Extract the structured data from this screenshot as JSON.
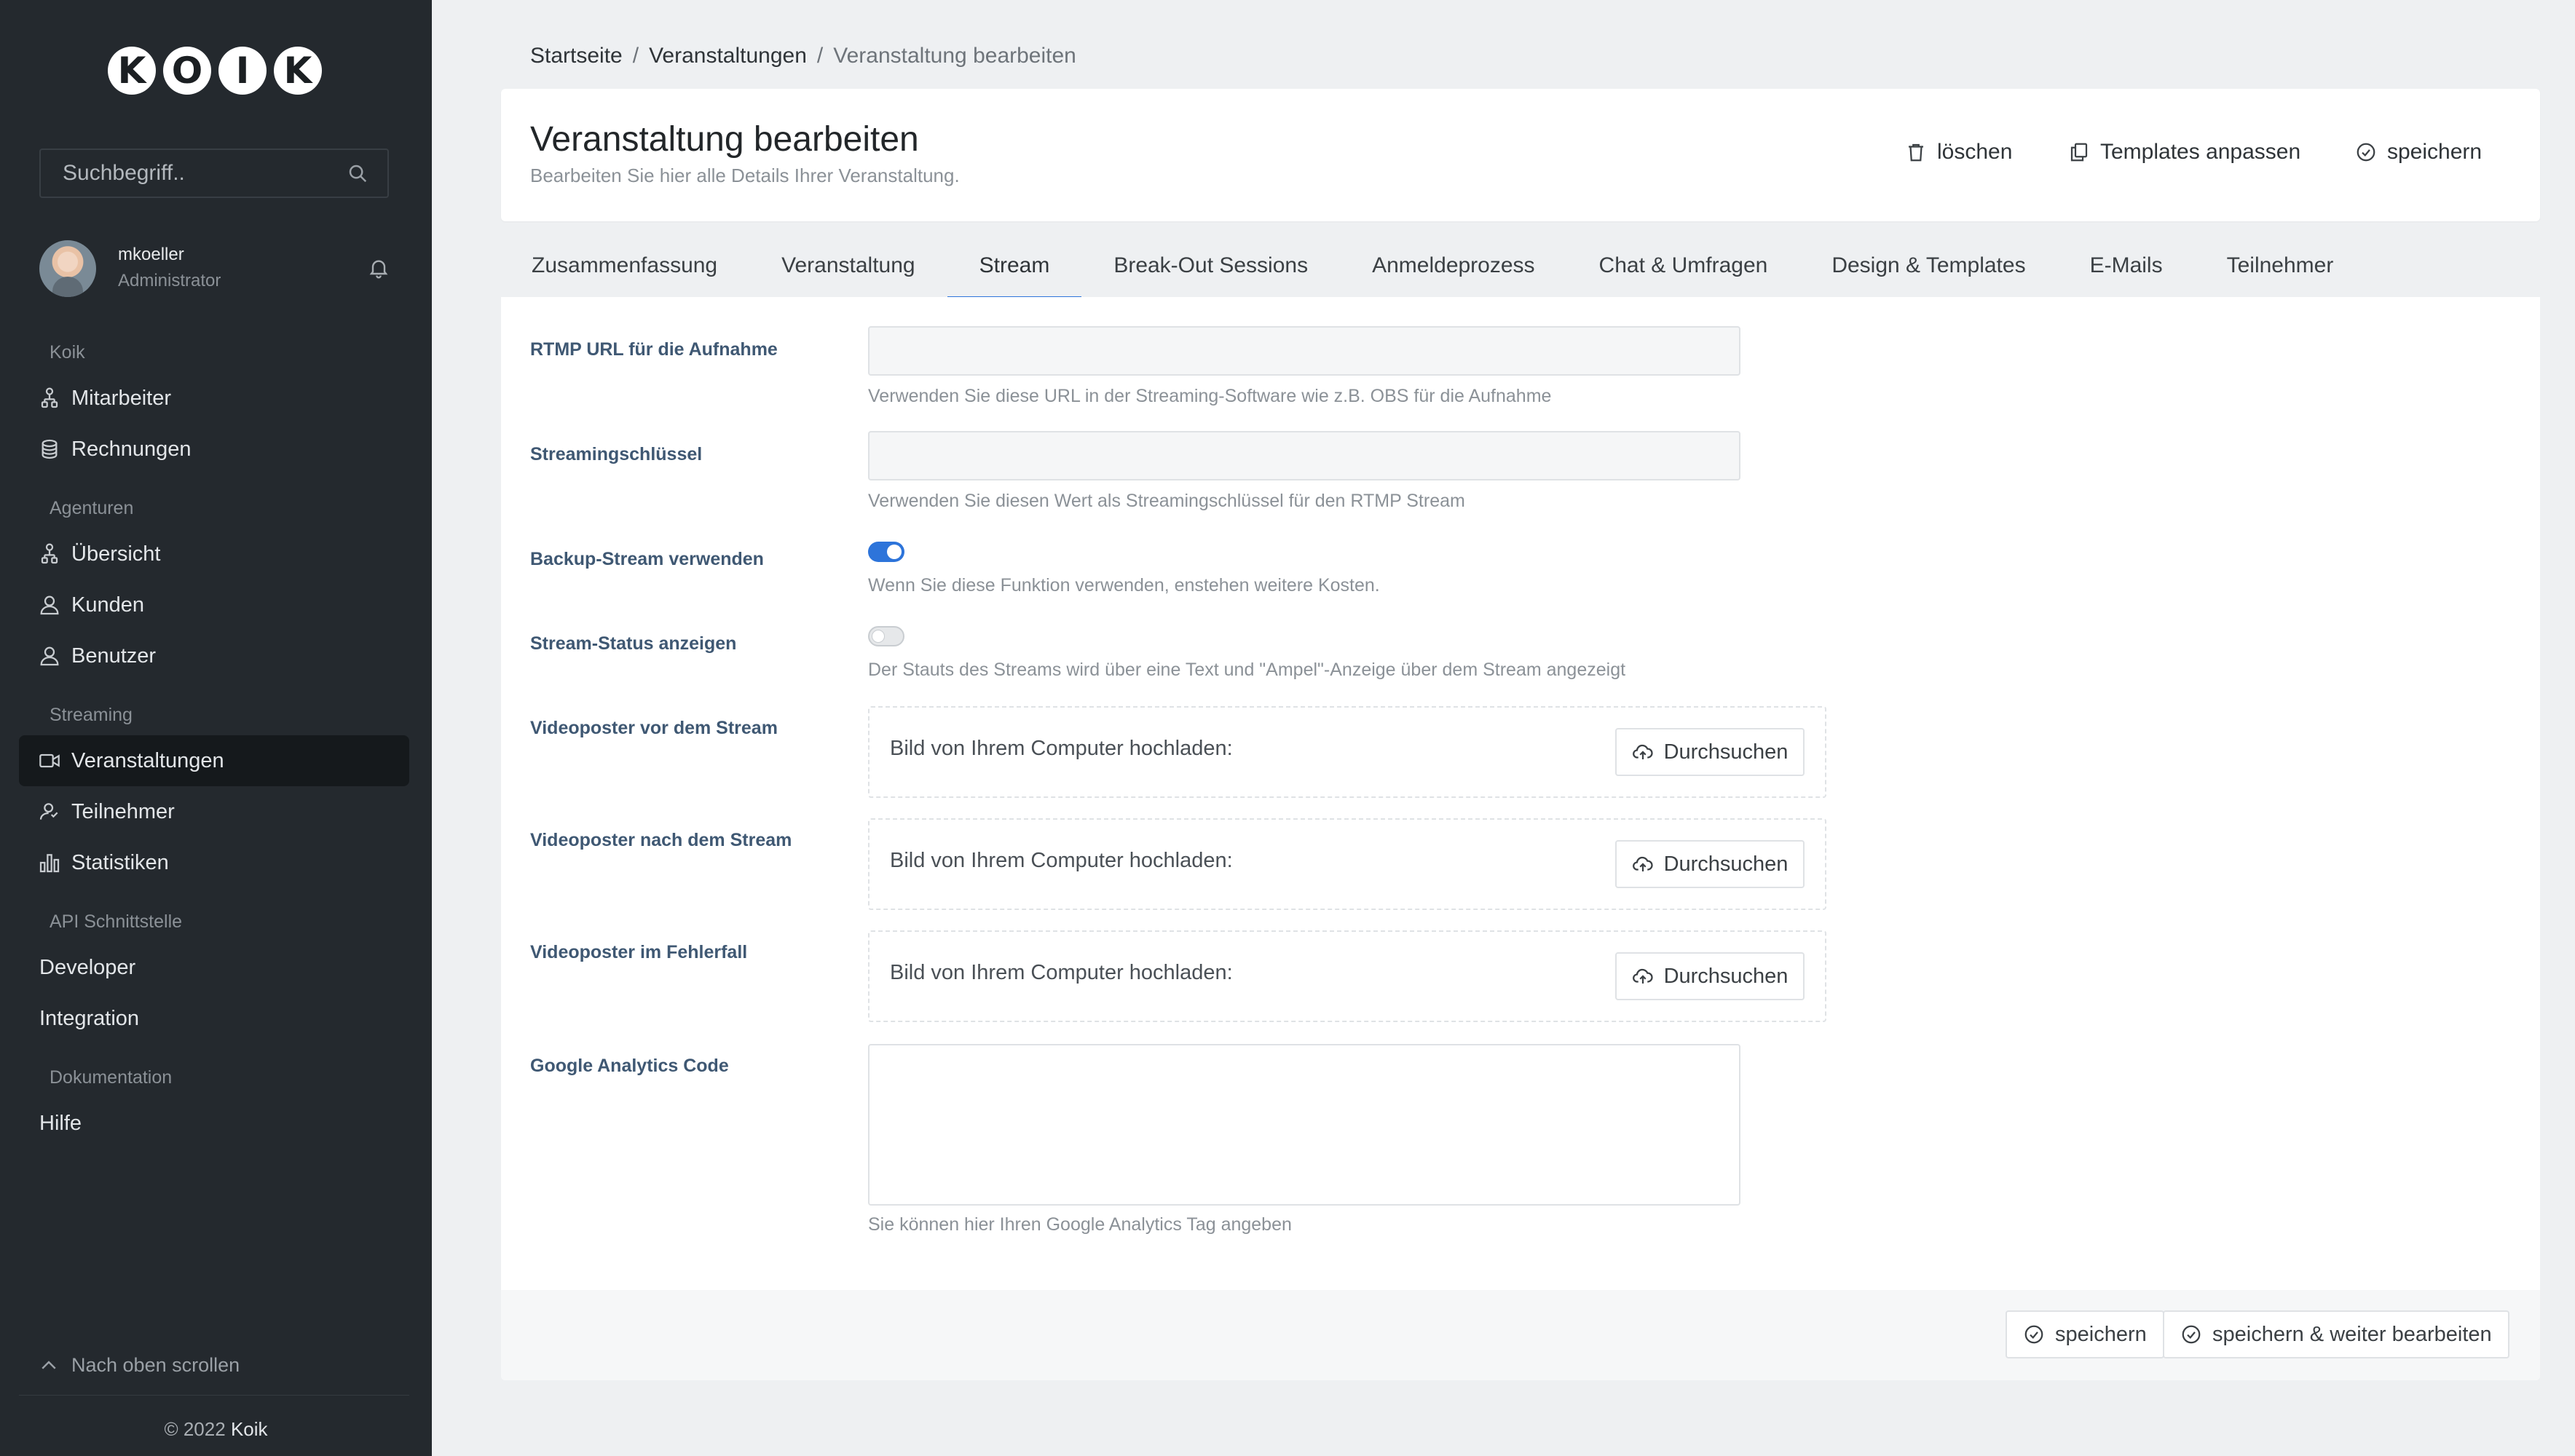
{
  "brand": {
    "logo_letters": [
      "K",
      "O",
      "I",
      "K"
    ]
  },
  "search": {
    "placeholder": "Suchbegriff.."
  },
  "user": {
    "name": "mkoeller",
    "role": "Administrator"
  },
  "sidebar": {
    "sections": [
      {
        "title": "Koik",
        "items": [
          {
            "label": "Mitarbeiter",
            "icon": "users-icon"
          },
          {
            "label": "Rechnungen",
            "icon": "coins-icon"
          }
        ]
      },
      {
        "title": "Agenturen",
        "items": [
          {
            "label": "Übersicht",
            "icon": "users-icon"
          },
          {
            "label": "Kunden",
            "icon": "user-icon"
          },
          {
            "label": "Benutzer",
            "icon": "user-icon"
          }
        ]
      },
      {
        "title": "Streaming",
        "items": [
          {
            "label": "Veranstaltungen",
            "icon": "video-icon",
            "active": true
          },
          {
            "label": "Teilnehmer",
            "icon": "user-group-icon"
          },
          {
            "label": "Statistiken",
            "icon": "bar-chart-icon"
          }
        ]
      },
      {
        "title": "API Schnittstelle",
        "items": [
          {
            "label": "Developer"
          },
          {
            "label": "Integration"
          }
        ]
      },
      {
        "title": "Dokumentation",
        "items": [
          {
            "label": "Hilfe"
          }
        ]
      }
    ],
    "scroll_top": "Nach oben scrollen",
    "copyright_prefix": "© 2022",
    "copyright_brand": "Koik"
  },
  "breadcrumb": {
    "home": "Startseite",
    "section": "Veranstaltungen",
    "current": "Veranstaltung bearbeiten"
  },
  "header": {
    "title": "Veranstaltung bearbeiten",
    "subtitle": "Bearbeiten Sie hier alle Details Ihrer Veranstaltung.",
    "delete_label": "löschen",
    "templates_label": "Templates anpassen",
    "save_label": "speichern"
  },
  "tabs": [
    "Zusammenfassung",
    "Veranstaltung",
    "Stream",
    "Break-Out Sessions",
    "Anmeldeprozess",
    "Chat & Umfragen",
    "Design & Templates",
    "E-Mails",
    "Teilnehmer"
  ],
  "active_tab": "Stream",
  "form": {
    "rtmp_label": "RTMP URL für die Aufnahme",
    "rtmp_value": "",
    "rtmp_help": "Verwenden Sie diese URL in der Streaming-Software wie z.B. OBS für die Aufnahme",
    "key_label": "Streamingschlüssel",
    "key_value": "",
    "key_help": "Verwenden Sie diesen Wert als Streamingschlüssel für den RTMP Stream",
    "backup_label": "Backup-Stream verwenden",
    "backup_on": true,
    "backup_help": "Wenn Sie diese Funktion verwenden, enstehen weitere Kosten.",
    "status_label": "Stream-Status anzeigen",
    "status_on": false,
    "status_help": "Der Stauts des Streams wird über eine Text und \"Ampel\"-Anzeige über dem Stream angezeigt",
    "poster_before_label": "Videoposter vor dem Stream",
    "poster_after_label": "Videoposter nach dem Stream",
    "poster_error_label": "Videoposter im Fehlerfall",
    "upload_text": "Bild von Ihrem Computer hochladen:",
    "browse_label": "Durchsuchen",
    "ga_label": "Google Analytics Code",
    "ga_value": "",
    "ga_help": "Sie können hier Ihren Google Analytics Tag angeben"
  },
  "footer": {
    "save_label": "speichern",
    "save_continue_label": "speichern & weiter bearbeiten"
  },
  "colors": {
    "sidebar_bg": "#24292e",
    "accent": "#2d74da",
    "label": "#3f5873"
  }
}
